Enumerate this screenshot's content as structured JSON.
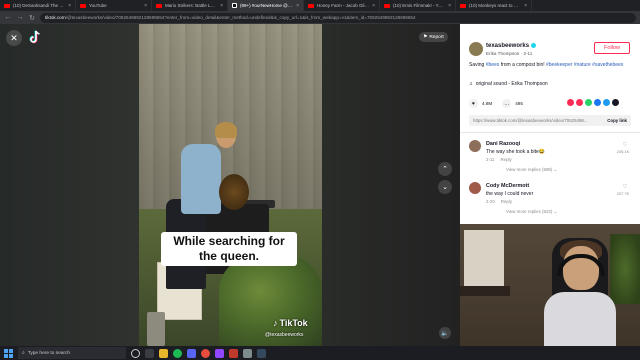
{
  "browser": {
    "tabs": [
      {
        "title": "(10) DeSantisandi The History of...",
        "icon": "youtube-icon"
      },
      {
        "title": "YouTube",
        "icon": "youtube-icon"
      },
      {
        "title": "Mario Strikers: Battle League -...",
        "icon": "youtube-icon"
      },
      {
        "title": "(99+) #ourNewHome @tyme...",
        "icon": "tiktok-icon",
        "active": true
      },
      {
        "title": "Honey Farm - Jacob Glitch (POV)...",
        "icon": "youtube-icon"
      },
      {
        "title": "(10) Emis Filmmak! - YouTube",
        "icon": "youtube-icon"
      },
      {
        "title": "(10) Monkeys react to magic...",
        "icon": "youtube-icon"
      }
    ],
    "url_domain": "tiktok.com",
    "url_rest": "/@texasbeeworks/video/7062549892128699654?enter_from=video_detail&enter_method=undefined&is_copy_url=1&is_from_webapp=v1&item_id=7062549892128699654"
  },
  "video": {
    "report_label": "Report",
    "caption": "While searching for the queen.",
    "watermark_brand": "TikTok",
    "watermark_handle": "@texasbeeworks"
  },
  "panel": {
    "author_handle": "texasbeeworks",
    "author_name": "Erika Thompson",
    "author_age": "2-11",
    "follow_label": "Follow",
    "description_text": "Saving ",
    "description_tags": [
      "#bees",
      " from a compost bin! ",
      "#beekeeper",
      " ",
      "#nature",
      " ",
      "#savethebees"
    ],
    "sound": "original sound - Erika Thompson",
    "likes": "4.8M",
    "comments_count": "495",
    "share_link": "https://www.tiktok.com/@texasbeeworks/video/70625498...",
    "copy_link_label": "Copy link",
    "comments": [
      {
        "name": "Dani Razooqi",
        "text": "The way she took a bite😂",
        "date": "2-11",
        "reply": "Reply",
        "likes": "245.1K",
        "more": "View more replies (599) ⌄",
        "avatar_color": "#8d6e5a"
      },
      {
        "name": "Cody McDermott",
        "text": "the way I could never",
        "date": "2-20",
        "reply": "Reply",
        "likes": "207.7K",
        "more": "View more replies (523) ⌄",
        "avatar_color": "#a05a4a"
      }
    ]
  },
  "taskbar": {
    "search_placeholder": "Type here to search"
  },
  "colors": {
    "tiktok_red": "#fe2c55",
    "hashtag_blue": "#2b5db9",
    "youtube_red": "#ff0000",
    "windows_blue": "#4ea3f5"
  }
}
